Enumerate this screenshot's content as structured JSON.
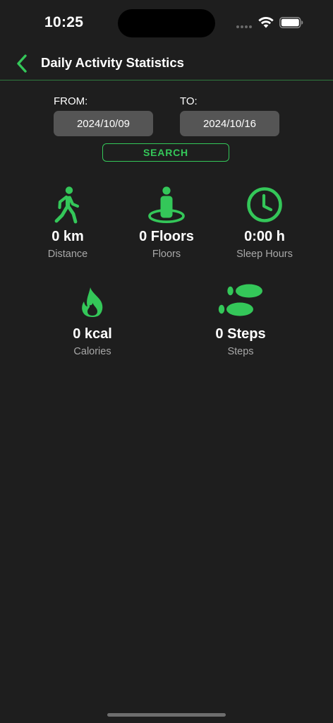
{
  "status_bar": {
    "time": "10:25"
  },
  "nav": {
    "title": "Daily Activity Statistics",
    "back_icon": "chevron-left-icon"
  },
  "date_range": {
    "from_label": "FROM:",
    "from_value": "2024/10/09",
    "to_label": "TO:",
    "to_value": "2024/10/16",
    "search_label": "SEARCH"
  },
  "stats": [
    {
      "icon": "walking-person-icon",
      "value": "0 km",
      "label": "Distance"
    },
    {
      "icon": "person-on-floor-icon",
      "value": "0 Floors",
      "label": "Floors"
    },
    {
      "icon": "clock-icon",
      "value": "0:00 h",
      "label": "Sleep Hours"
    },
    {
      "icon": "flame-icon",
      "value": "0 kcal",
      "label": "Calories"
    },
    {
      "icon": "footprints-icon",
      "value": "0 Steps",
      "label": "Steps"
    }
  ],
  "colors": {
    "accent": "#34c759",
    "background": "#1e1e1e",
    "field_background": "#555555",
    "secondary_text": "#a8a8a8"
  }
}
